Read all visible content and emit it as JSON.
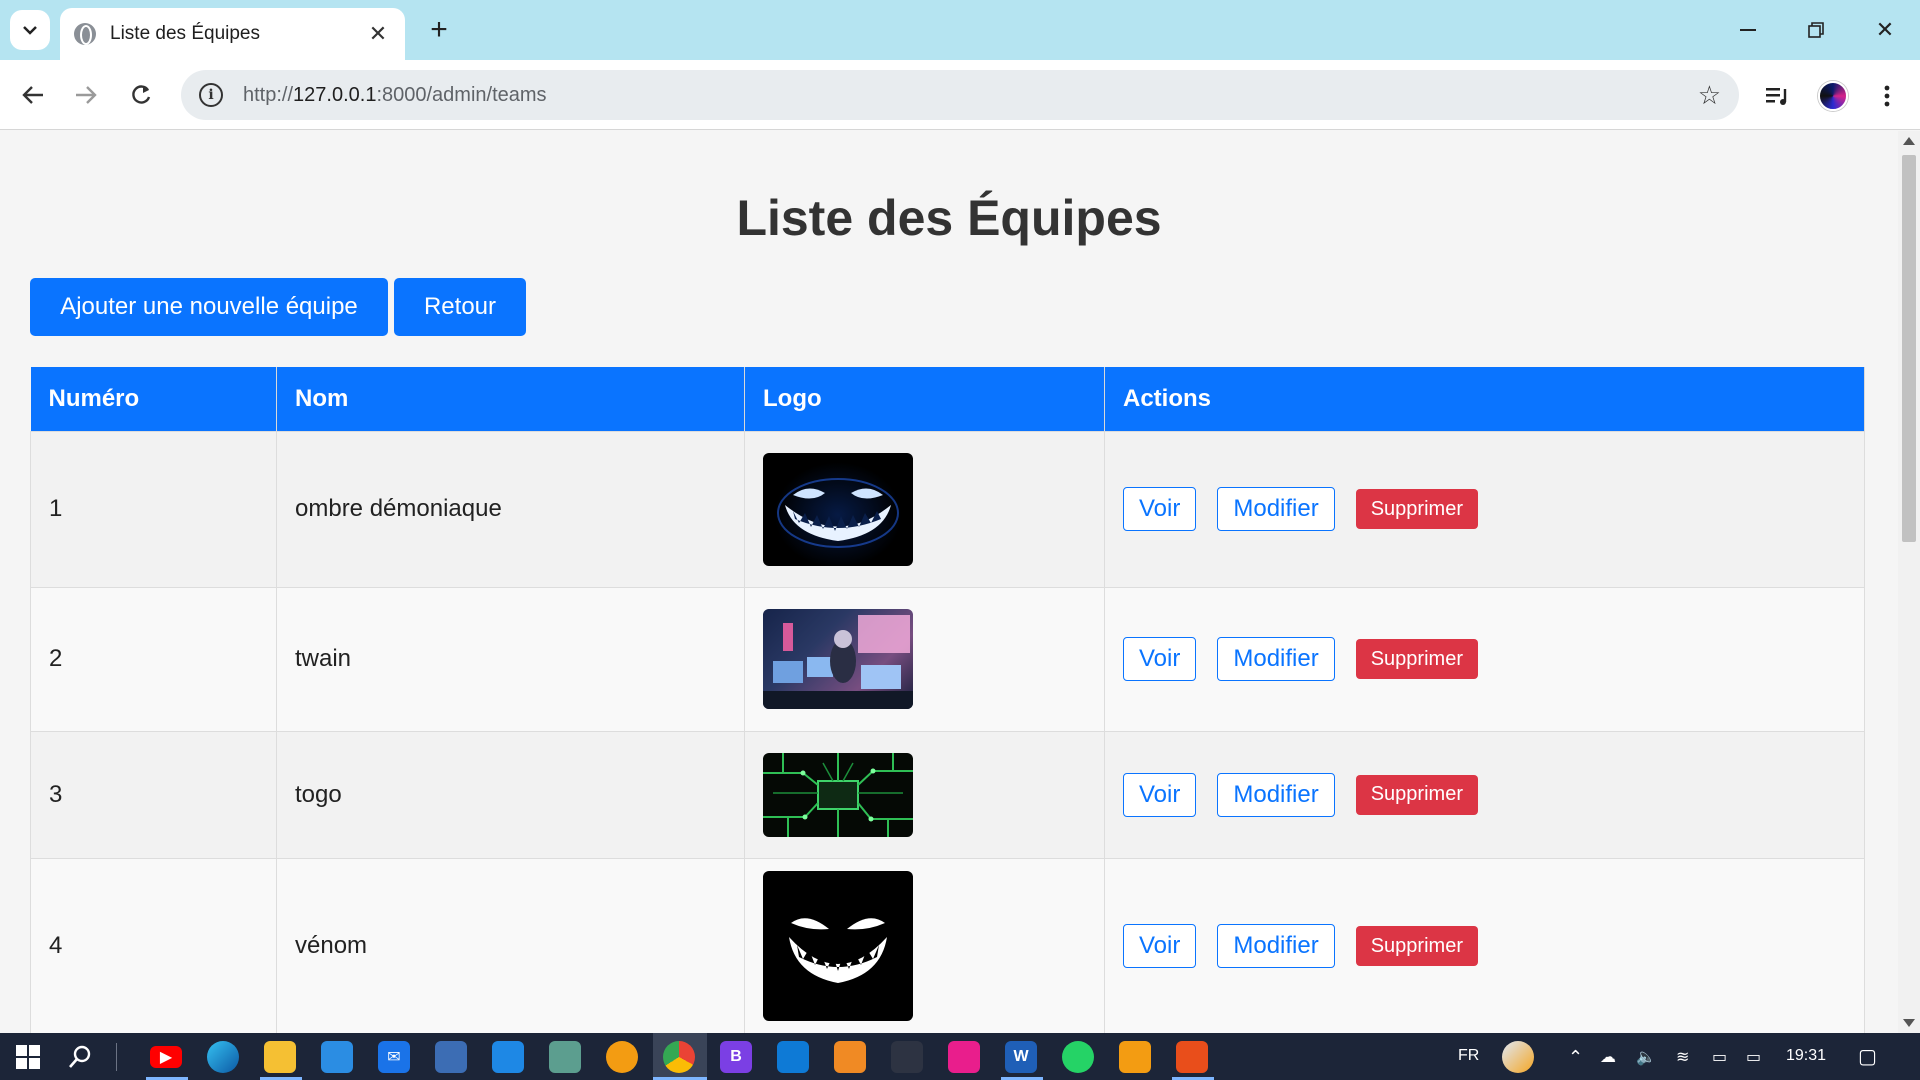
{
  "browser": {
    "tab_title": "Liste des Équipes",
    "url_prefix": "http://",
    "url_host": "127.0.0.1",
    "url_rest": ":8000/admin/teams"
  },
  "page": {
    "title": "Liste des Équipes",
    "add_button": "Ajouter une nouvelle équipe",
    "back_button": "Retour"
  },
  "table": {
    "headers": [
      "Numéro",
      "Nom",
      "Logo",
      "Actions"
    ],
    "rows": [
      {
        "numero": "1",
        "nom": "ombre démoniaque",
        "logo_icon": "grinning-demon-logo"
      },
      {
        "numero": "2",
        "nom": "twain",
        "logo_icon": "gamer-room-logo"
      },
      {
        "numero": "3",
        "nom": "togo",
        "logo_icon": "circuit-board-logo"
      },
      {
        "numero": "4",
        "nom": "vénom",
        "logo_icon": "venom-grin-logo"
      }
    ],
    "actions": {
      "view": "Voir",
      "edit": "Modifier",
      "delete": "Supprimer"
    }
  },
  "taskbar": {
    "language": "FR",
    "time": "19:31"
  },
  "colors": {
    "primary": "#0a74ff",
    "danger": "#dc3545",
    "tabstrip": "#b5e4f1",
    "taskbar": "#1c2538"
  }
}
